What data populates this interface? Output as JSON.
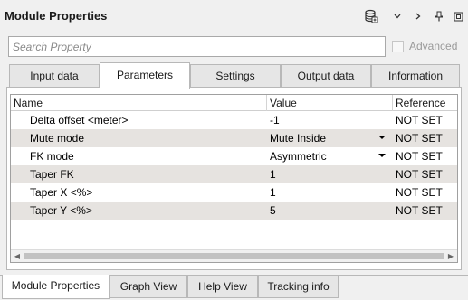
{
  "window": {
    "title": "Module Properties",
    "icons": [
      "database-icon",
      "chevron-down-icon",
      "chevron-right-icon",
      "pin-icon",
      "restore-window-icon"
    ]
  },
  "search": {
    "placeholder": "Search Property",
    "value": ""
  },
  "advanced": {
    "label": "Advanced",
    "checked": false
  },
  "tabs": [
    {
      "label": "Input data"
    },
    {
      "label": "Parameters"
    },
    {
      "label": "Settings"
    },
    {
      "label": "Output data"
    },
    {
      "label": "Information"
    }
  ],
  "active_tab": "Parameters",
  "grid": {
    "columns": [
      "Name",
      "Value",
      "Reference"
    ],
    "rows": [
      {
        "name": "Delta offset <meter>",
        "value": "-1",
        "reference": "NOT SET",
        "dropdown": false
      },
      {
        "name": "Mute mode",
        "value": "Mute Inside",
        "reference": "NOT SET",
        "dropdown": true
      },
      {
        "name": "FK mode",
        "value": "Asymmetric",
        "reference": "NOT SET",
        "dropdown": true
      },
      {
        "name": "Taper FK",
        "value": "1",
        "reference": "NOT SET",
        "dropdown": false
      },
      {
        "name": "Taper X <%>",
        "value": "1",
        "reference": "NOT SET",
        "dropdown": false
      },
      {
        "name": "Taper Y <%>",
        "value": "5",
        "reference": "NOT SET",
        "dropdown": false
      }
    ]
  },
  "bottom_tabs": [
    {
      "label": "Module Properties"
    },
    {
      "label": "Graph View"
    },
    {
      "label": "Help View"
    },
    {
      "label": "Tracking info"
    }
  ],
  "active_bottom_tab": "Module Properties",
  "colors": {
    "row_alt": "#e6e3e0",
    "background": "#f0f0f0",
    "border": "#b8b8b8"
  }
}
